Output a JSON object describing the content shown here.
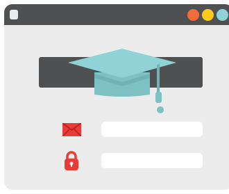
{
  "colors": {
    "window_background": "#ececec",
    "titlebar": "#4f5052",
    "banner": "#4f5052",
    "window_buttons": [
      "#f26b3a",
      "#fdca1b",
      "#8fd3d6"
    ],
    "cap_top": "#8fd3d6",
    "cap_band": "#7ec1c4",
    "cap_shadow": "#6fb3b7",
    "mail_icon": "#ea3c36",
    "lock_icon": "#ea3c36",
    "field_background": "#ffffff"
  },
  "icons": {
    "menu": "menu-square-icon",
    "hero": "graduation-cap-icon",
    "email": "mail-icon",
    "password": "lock-icon"
  },
  "form": {
    "email_value": "",
    "email_placeholder": "",
    "password_value": "",
    "password_placeholder": ""
  }
}
